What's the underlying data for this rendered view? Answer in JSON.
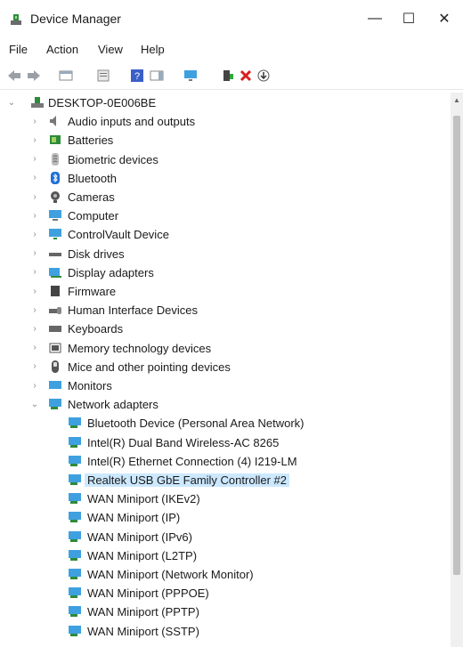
{
  "window": {
    "title": "Device Manager",
    "minimize_glyph": "—",
    "maximize_glyph": "☐",
    "close_glyph": "✕"
  },
  "menubar": [
    "File",
    "Action",
    "View",
    "Help"
  ],
  "toolbar": [
    "back-arrow-icon",
    "forward-arrow-icon",
    "show-hide-tree-icon",
    "properties-icon",
    "help-icon",
    "action-pane-icon",
    "monitor-icon",
    "update-driver-icon",
    "uninstall-device-icon",
    "scan-hardware-icon"
  ],
  "tree": {
    "root": "DESKTOP-0E006BE",
    "categories": [
      {
        "label": "Audio inputs and outputs",
        "icon": "speaker-icon"
      },
      {
        "label": "Batteries",
        "icon": "battery-icon"
      },
      {
        "label": "Biometric devices",
        "icon": "biometric-icon"
      },
      {
        "label": "Bluetooth",
        "icon": "bluetooth-icon"
      },
      {
        "label": "Cameras",
        "icon": "camera-icon"
      },
      {
        "label": "Computer",
        "icon": "computer-icon"
      },
      {
        "label": "ControlVault Device",
        "icon": "controlvault-icon"
      },
      {
        "label": "Disk drives",
        "icon": "disk-drive-icon"
      },
      {
        "label": "Display adapters",
        "icon": "display-adapter-icon"
      },
      {
        "label": "Firmware",
        "icon": "firmware-icon"
      },
      {
        "label": "Human Interface Devices",
        "icon": "hid-icon"
      },
      {
        "label": "Keyboards",
        "icon": "keyboard-icon"
      },
      {
        "label": "Memory technology devices",
        "icon": "memory-icon"
      },
      {
        "label": "Mice and other pointing devices",
        "icon": "mouse-icon"
      },
      {
        "label": "Monitors",
        "icon": "monitor-icon"
      },
      {
        "label": "Network adapters",
        "icon": "network-adapter-icon",
        "expanded": true
      }
    ],
    "network_adapters": [
      "Bluetooth Device (Personal Area Network)",
      "Intel(R) Dual Band Wireless-AC 8265",
      "Intel(R) Ethernet Connection (4) I219-LM",
      "Realtek USB GbE Family Controller #2",
      "WAN Miniport (IKEv2)",
      "WAN Miniport (IP)",
      "WAN Miniport (IPv6)",
      "WAN Miniport (L2TP)",
      "WAN Miniport (Network Monitor)",
      "WAN Miniport (PPPOE)",
      "WAN Miniport (PPTP)",
      "WAN Miniport (SSTP)"
    ],
    "selected": "Realtek USB GbE Family Controller #2"
  },
  "colors": {
    "selection": "#cce8ff",
    "accent": "#1f7fd8",
    "uninstall": "#d81e1e"
  }
}
